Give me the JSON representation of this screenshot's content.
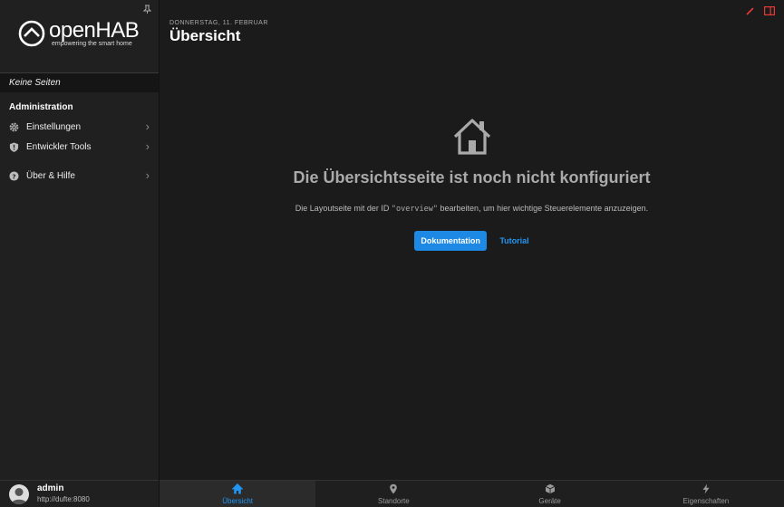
{
  "sidebar": {
    "logo_text": "openHAB",
    "logo_subtitle": "empowering the smart home",
    "no_pages": "Keine Seiten",
    "section_title": "Administration",
    "items": [
      {
        "label": "Einstellungen",
        "icon": "gear-icon"
      },
      {
        "label": "Entwickler Tools",
        "icon": "shield-icon"
      },
      {
        "label": "Über & Hilfe",
        "icon": "help-icon"
      }
    ],
    "user": {
      "name": "admin",
      "url": "http://dufte:8080"
    }
  },
  "header": {
    "date": "DONNERSTAG, 11. FEBRUAR",
    "title": "Übersicht"
  },
  "empty_state": {
    "title": "Die Übersichtsseite ist noch nicht konfiguriert",
    "desc_before": "Die Layoutseite mit der ID ",
    "desc_code": "\"overview\"",
    "desc_after": " bearbeiten, um hier wichtige Steuerelemente anzuzeigen.",
    "primary_button": "Dokumentation",
    "secondary_link": "Tutorial"
  },
  "tabs": [
    {
      "label": "Übersicht",
      "icon": "home-icon",
      "active": true
    },
    {
      "label": "Standorte",
      "icon": "location-pin-icon"
    },
    {
      "label": "Geräte",
      "icon": "cube-icon"
    },
    {
      "label": "Eigenschaften",
      "icon": "bolt-icon"
    }
  ],
  "colors": {
    "accent": "#1e88e5",
    "edit_icon": "#e53935"
  }
}
